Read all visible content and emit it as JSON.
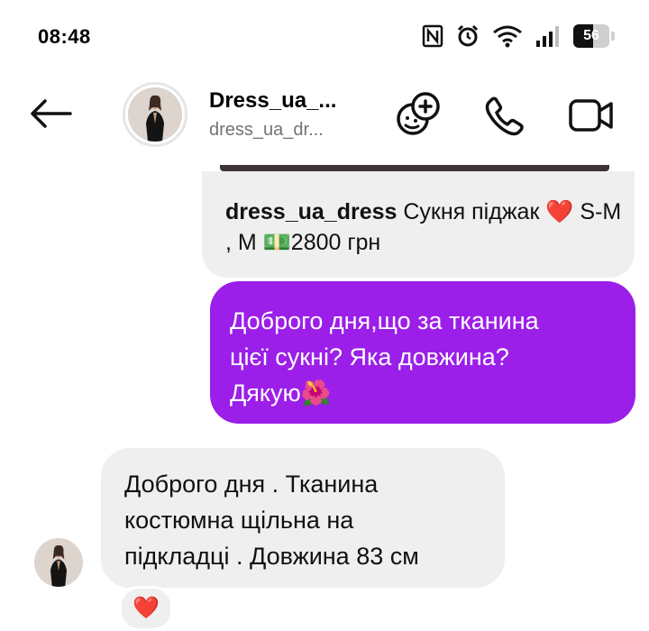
{
  "status_bar": {
    "time": "08:48",
    "battery_percent": "56",
    "icons": [
      "nfc-icon",
      "alarm-icon",
      "wifi-icon",
      "signal-icon",
      "battery-icon"
    ]
  },
  "header": {
    "display_name": "Dress_ua_...",
    "username": "dress_ua_dr...",
    "icons": [
      "back-arrow-icon",
      "effects-icon",
      "phone-icon",
      "video-icon"
    ]
  },
  "thread": {
    "shared_post": {
      "handle": "dress_ua_dress",
      "caption": "Сукня піджак ❤️ S-M , M 💵2800 грн"
    },
    "outgoing_message": "Доброго дня,що за тканина\nцієї сукні? Яка довжина?\nДякую🌺",
    "incoming_message": "Доброго дня . Тканина\nкостюмна щільна на\nпідкладці . Довжина 83 см",
    "reaction": "❤️"
  },
  "colors": {
    "outgoing_bubble": "#9b1fe8",
    "incoming_bubble": "#efefef",
    "secondary_text": "#737373"
  }
}
